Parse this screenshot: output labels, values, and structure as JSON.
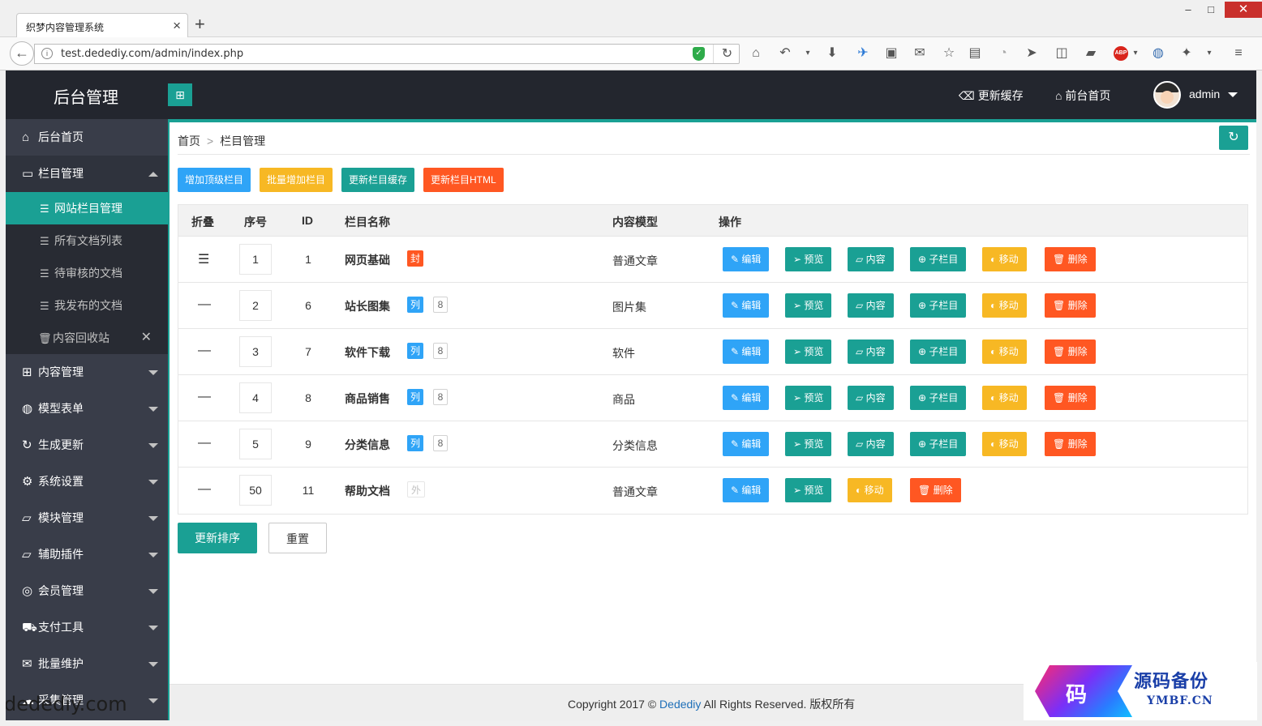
{
  "browser": {
    "tab_title": "织梦内容管理系统",
    "url": "test.dedediy.com/admin/index.php",
    "win_min": "–",
    "win_max": "□",
    "win_close": "✕"
  },
  "header": {
    "brand": "后台管理",
    "refresh_cache": "更新缓存",
    "frontend_home": "前台首页",
    "user": "admin"
  },
  "sidebar": {
    "items": [
      {
        "label": "后台首页",
        "icon": "home-icon"
      },
      {
        "label": "栏目管理",
        "icon": "monitor-icon"
      },
      {
        "label": "内容管理",
        "icon": "apps-icon"
      },
      {
        "label": "模型表单",
        "icon": "globe-icon"
      },
      {
        "label": "生成更新",
        "icon": "refresh-icon"
      },
      {
        "label": "系统设置",
        "icon": "gear-icon"
      },
      {
        "label": "模块管理",
        "icon": "folder-icon"
      },
      {
        "label": "辅助插件",
        "icon": "folder-icon"
      },
      {
        "label": "会员管理",
        "icon": "user-icon"
      },
      {
        "label": "支付工具",
        "icon": "cart-icon"
      },
      {
        "label": "批量维护",
        "icon": "mail-icon"
      },
      {
        "label": "采集管理",
        "icon": "cloud-icon"
      }
    ],
    "sub_items": [
      {
        "label": "网站栏目管理"
      },
      {
        "label": "所有文档列表"
      },
      {
        "label": "待审核的文档"
      },
      {
        "label": "我发布的文档"
      },
      {
        "label": "内容回收站"
      }
    ],
    "watermark": "dedediy.com"
  },
  "breadcrumb": {
    "home": "首页",
    "current": "栏目管理"
  },
  "actions": {
    "add_top": "增加顶级栏目",
    "batch_add": "批量增加栏目",
    "update_cache": "更新栏目缓存",
    "update_html": "更新栏目HTML"
  },
  "table": {
    "headers": [
      "折叠",
      "序号",
      "ID",
      "栏目名称",
      "内容模型",
      "操作"
    ],
    "rows": [
      {
        "fold": "☰",
        "order": "1",
        "id": "1",
        "name": "网页基础",
        "tag": "封",
        "count": "",
        "model": "普通文章"
      },
      {
        "fold": "—",
        "order": "2",
        "id": "6",
        "name": "站长图集",
        "tag": "列",
        "count": "8",
        "model": "图片集"
      },
      {
        "fold": "—",
        "order": "3",
        "id": "7",
        "name": "软件下载",
        "tag": "列",
        "count": "8",
        "model": "软件"
      },
      {
        "fold": "—",
        "order": "4",
        "id": "8",
        "name": "商品销售",
        "tag": "列",
        "count": "8",
        "model": "商品"
      },
      {
        "fold": "—",
        "order": "5",
        "id": "9",
        "name": "分类信息",
        "tag": "列",
        "count": "8",
        "model": "分类信息"
      },
      {
        "fold": "—",
        "order": "50",
        "id": "11",
        "name": "帮助文档",
        "tag": "外",
        "count": "",
        "model": "普通文章"
      }
    ],
    "ops": {
      "edit": "编辑",
      "preview": "预览",
      "content": "内容",
      "child": "子栏目",
      "move": "移动",
      "delete": "删除"
    }
  },
  "bottom": {
    "update_order": "更新排序",
    "reset": "重置"
  },
  "footer": {
    "prefix": "Copyright 2017 © ",
    "brand": "Dedediy",
    "suffix": " All Rights Reserved. 版权所有"
  },
  "watermark_logo": {
    "char": "码",
    "cn": "源码备份",
    "en": "YMBF.CN"
  },
  "colors": {
    "green": "#1aa094",
    "blue": "#2fa4f7",
    "yellow": "#f7b824",
    "orange": "#ff5722",
    "sidebar": "#393d49",
    "header": "#23262e"
  }
}
